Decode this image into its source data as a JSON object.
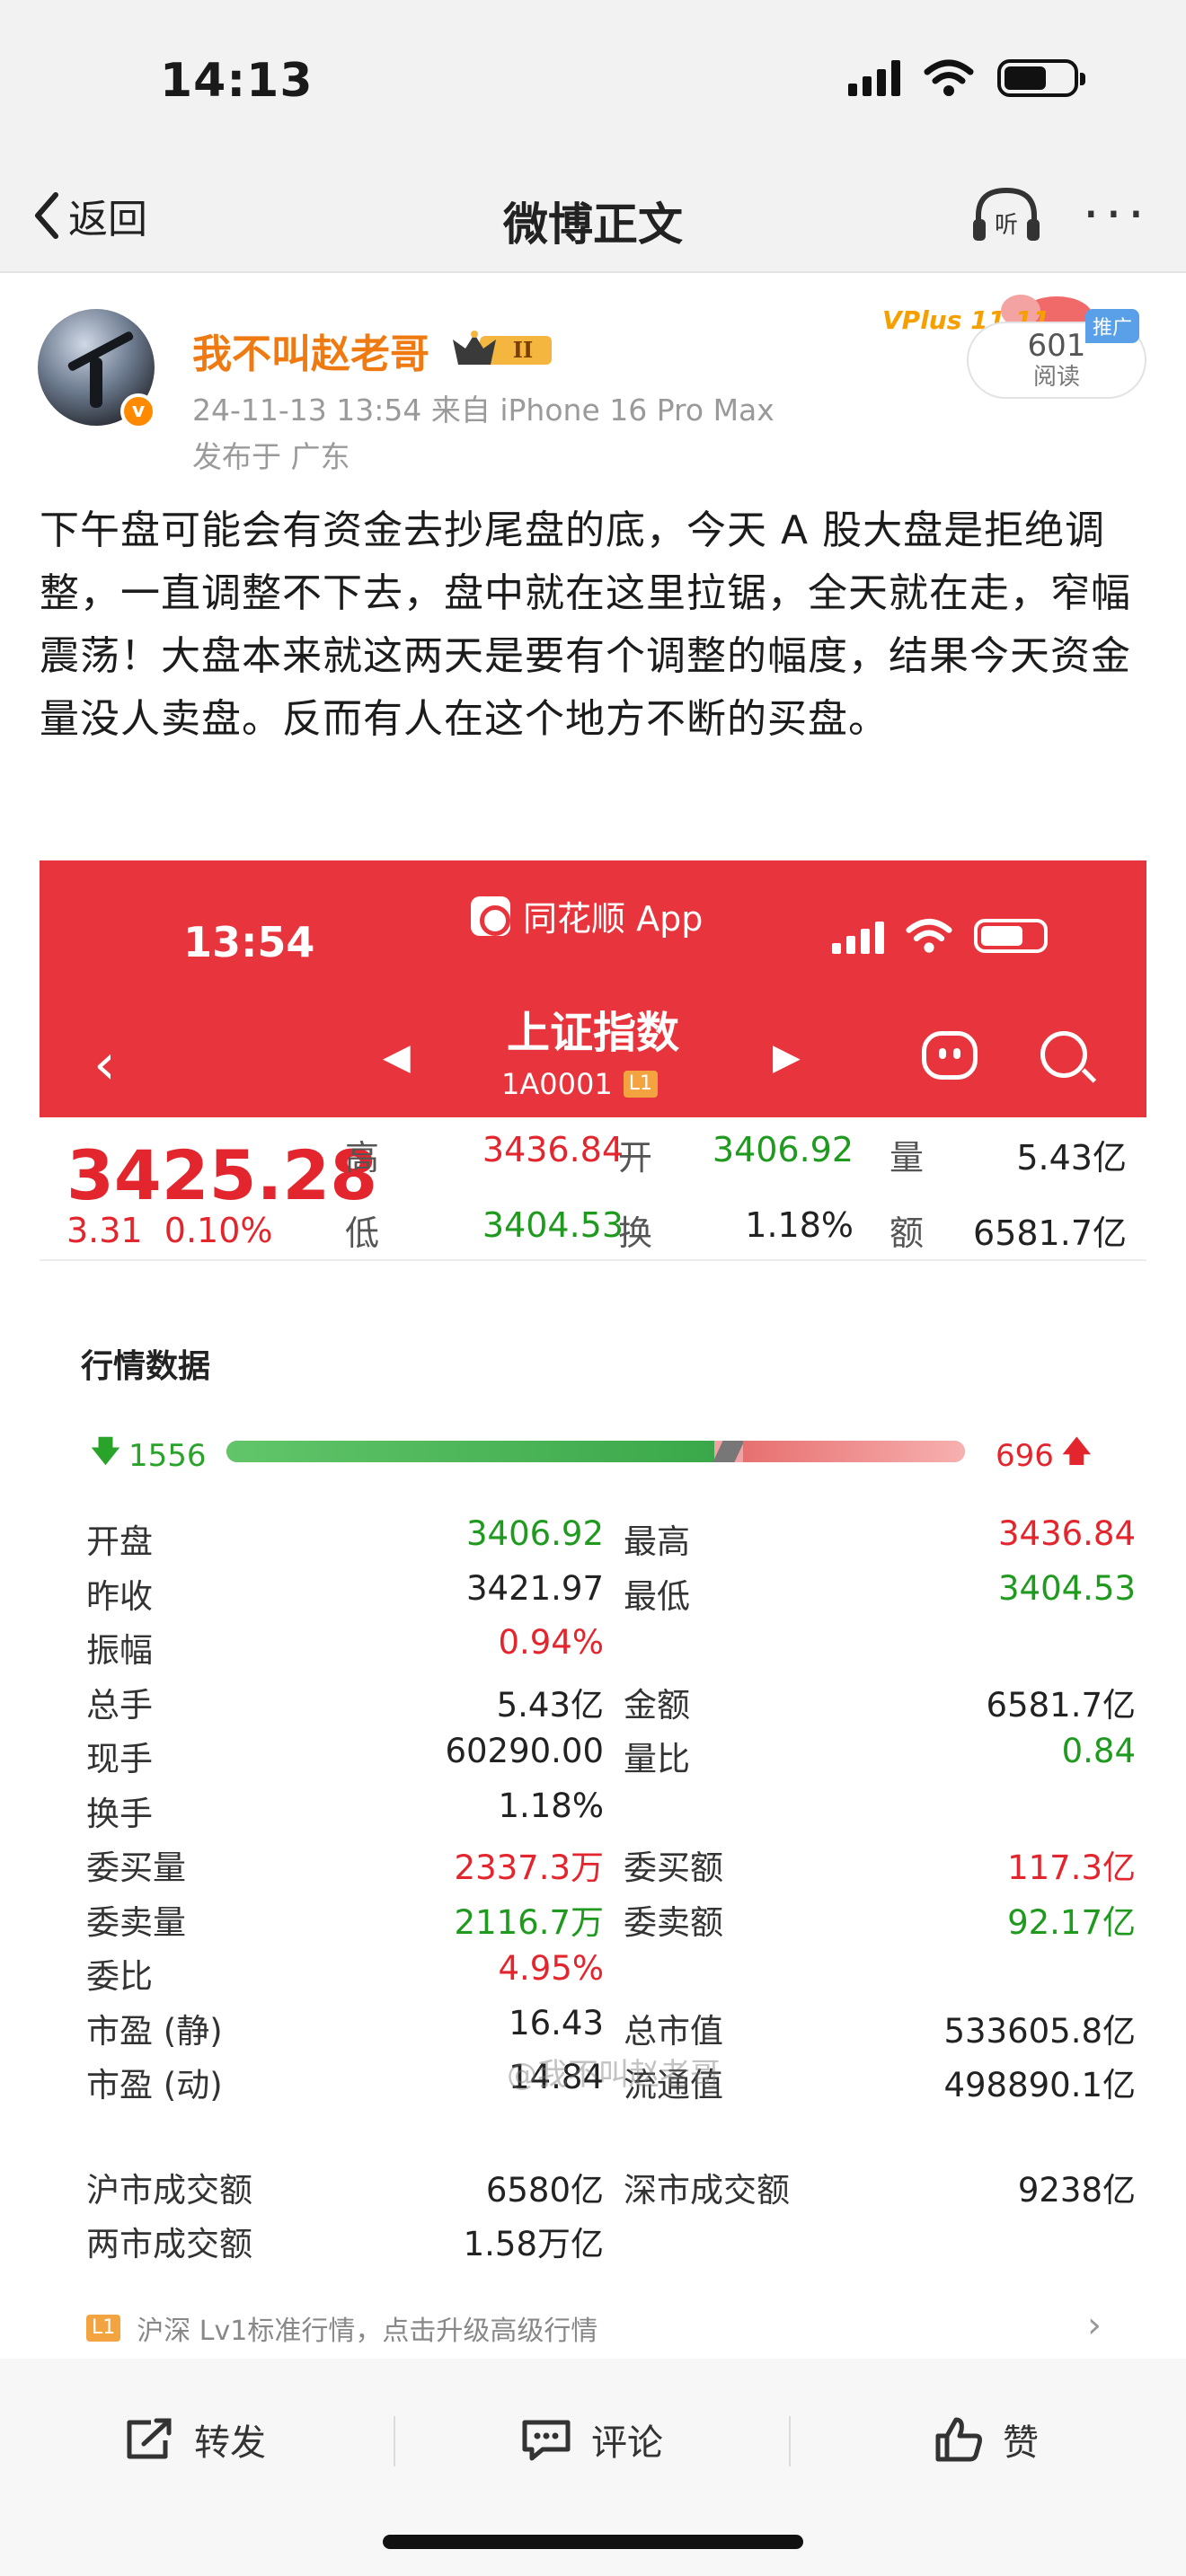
{
  "status_bar": {
    "time": "14:13"
  },
  "nav": {
    "back_label": "返回",
    "title": "微博正文",
    "listen_label": "听"
  },
  "author": {
    "name": "我不叫赵老哥",
    "level_badge": "II",
    "meta": "24-11-13 13:54  来自 iPhone 16 Pro Max",
    "location": "发布于 广东",
    "read_count": "601",
    "read_label": "阅读",
    "promo_tag": "推广",
    "vplus_label": "VPlus 11.11"
  },
  "post": {
    "text": "下午盘可能会有资金去抄尾盘的底，今天 A 股大盘是拒绝调整，一直调整不下去，盘中就在这里拉锯，全天就在走，窄幅震荡！大盘本来就这两天是要有个调整的幅度，结果今天资金量没人卖盘。反而有人在这个地方不断的买盘。"
  },
  "screenshot": {
    "time": "13:54",
    "app_name": "同花顺 App",
    "title": "上证指数",
    "code": "1A0001",
    "code_tag": "L1",
    "price": "3425.28",
    "change": "3.31",
    "change_pct": "0.10%",
    "quote": [
      {
        "label": "高",
        "value": "3436.84",
        "color": "#e3262d"
      },
      {
        "label": "开",
        "value": "3406.92",
        "color": "#1f9a1f"
      },
      {
        "label": "量",
        "value": "5.43亿",
        "color": "#222222"
      },
      {
        "label": "低",
        "value": "3404.53",
        "color": "#1f9a1f"
      },
      {
        "label": "换",
        "value": "1.18%",
        "color": "#222222"
      },
      {
        "label": "额",
        "value": "6581.7亿",
        "color": "#222222"
      }
    ],
    "market_data_title": "行情数据",
    "decliners": "1556",
    "advancers": "696",
    "breadth": {
      "declining_share": 0.66,
      "advancing_share": 0.3
    },
    "left_rows": [
      {
        "label": "开盘",
        "value": "3406.92",
        "tone": "green"
      },
      {
        "label": "昨收",
        "value": "3421.97",
        "tone": ""
      },
      {
        "label": "振幅",
        "value": "0.94%",
        "tone": "red"
      },
      {
        "label": "总手",
        "value": "5.43亿",
        "tone": ""
      },
      {
        "label": "现手",
        "value": "60290.00",
        "tone": ""
      },
      {
        "label": "换手",
        "value": "1.18%",
        "tone": ""
      },
      {
        "label": "委买量",
        "value": "2337.3万",
        "tone": "red"
      },
      {
        "label": "委卖量",
        "value": "2116.7万",
        "tone": "green"
      },
      {
        "label": "委比",
        "value": "4.95%",
        "tone": "red"
      },
      {
        "label": "市盈 (静)",
        "value": "16.43",
        "tone": ""
      },
      {
        "label": "市盈 (动)",
        "value": "14.84",
        "tone": ""
      }
    ],
    "right_rows": [
      {
        "label": "最高",
        "value": "3436.84",
        "tone": "red"
      },
      {
        "label": "最低",
        "value": "3404.53",
        "tone": "green"
      },
      {
        "label": "金额",
        "value": "6581.7亿",
        "tone": ""
      },
      {
        "label": "量比",
        "value": "0.84",
        "tone": "green"
      },
      {
        "label": "委买额",
        "value": "117.3亿",
        "tone": "red"
      },
      {
        "label": "委卖额",
        "value": "92.17亿",
        "tone": "green"
      },
      {
        "label": "总市值",
        "value": "533605.8亿",
        "tone": ""
      },
      {
        "label": "流通值",
        "value": "498890.1亿",
        "tone": ""
      }
    ],
    "turnover": [
      {
        "label": "沪市成交额",
        "value": "6580亿"
      },
      {
        "label": "深市成交额",
        "value": "9238亿"
      },
      {
        "label": "两市成交额",
        "value": "1.58万亿"
      }
    ],
    "watermark": "@我不叫赵老哥",
    "upgrade_text": "沪深 Lv1标准行情，点击升级高级行情"
  },
  "actions": {
    "repost": "转发",
    "comment": "评论",
    "like": "赞"
  },
  "colors": {
    "up": "#e3262d",
    "down": "#1f9a1f",
    "header_red": "#e8343c",
    "name_orange": "#ef7a12"
  }
}
